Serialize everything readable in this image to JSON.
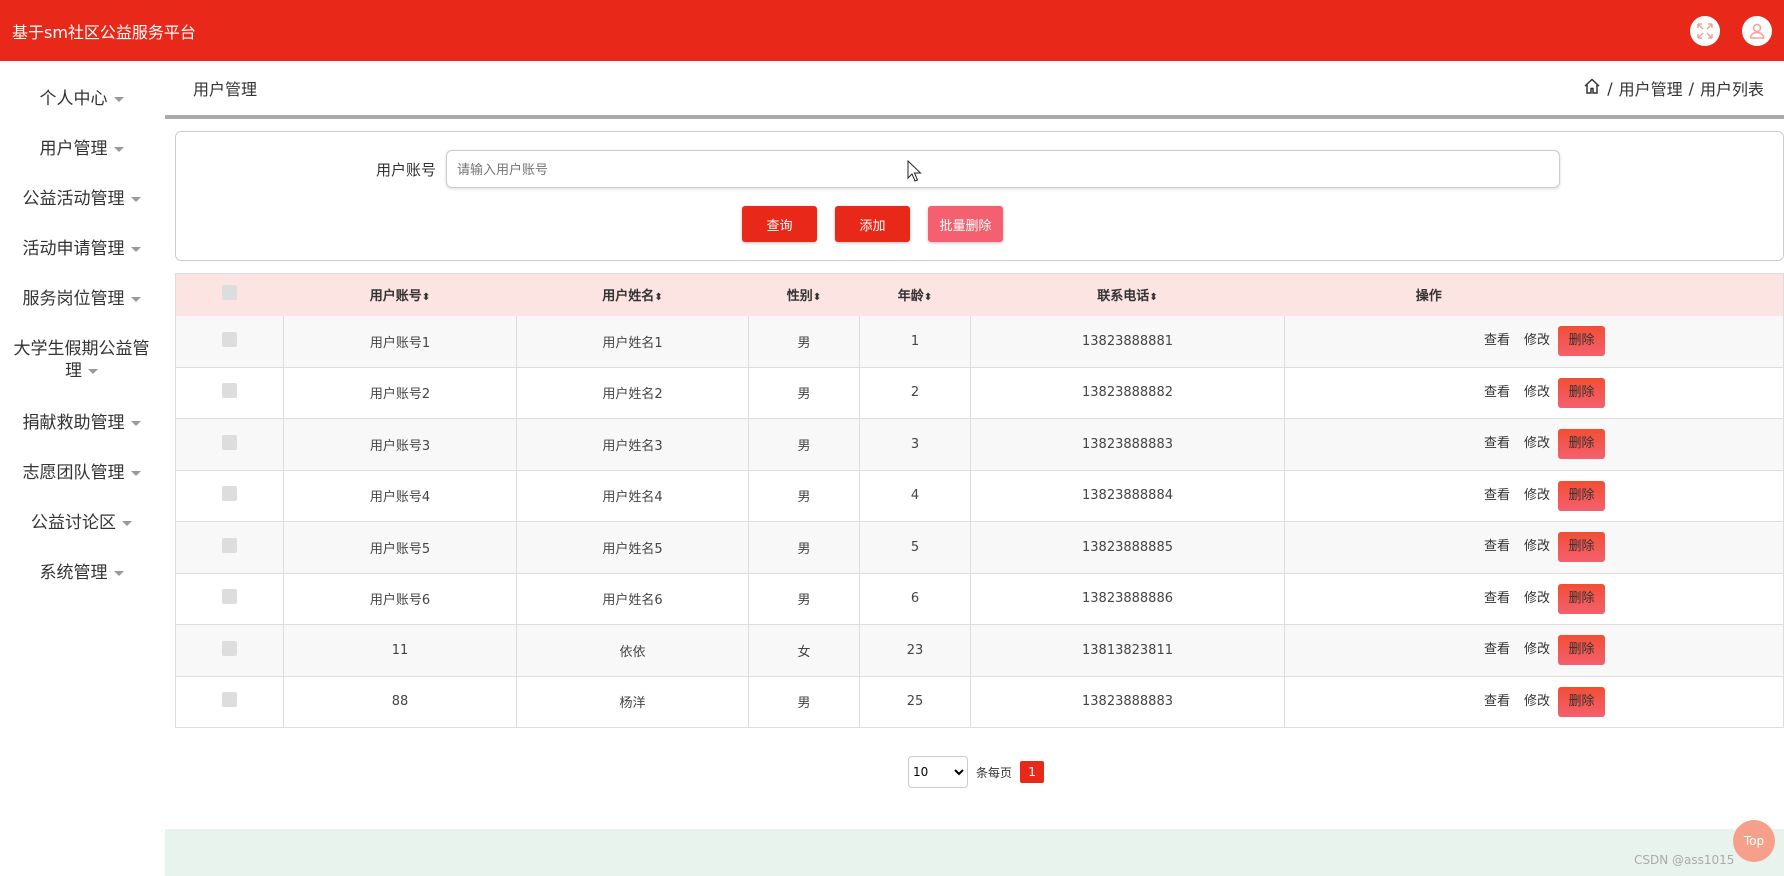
{
  "app": {
    "title": "基于sm社区公益服务平台"
  },
  "sidebar": {
    "items": [
      {
        "label": "个人中心"
      },
      {
        "label": "用户管理"
      },
      {
        "label": "公益活动管理"
      },
      {
        "label": "活动申请管理"
      },
      {
        "label": "服务岗位管理"
      },
      {
        "label": "大学生假期公益管理"
      },
      {
        "label": "捐献救助管理"
      },
      {
        "label": "志愿团队管理"
      },
      {
        "label": "公益讨论区"
      },
      {
        "label": "系统管理"
      }
    ]
  },
  "header": {
    "title": "用户管理",
    "breadcrumb": [
      "用户管理",
      "用户列表"
    ]
  },
  "search": {
    "label": "用户账号",
    "placeholder": "请输入用户账号",
    "query_label": "查询",
    "add_label": "添加",
    "batch_delete_label": "批量删除"
  },
  "table": {
    "columns": [
      "用户账号",
      "用户姓名",
      "性别",
      "年龄",
      "联系电话",
      "操作"
    ],
    "rows": [
      {
        "account": "用户账号1",
        "name": "用户姓名1",
        "gender": "男",
        "age": "1",
        "phone": "13823888881"
      },
      {
        "account": "用户账号2",
        "name": "用户姓名2",
        "gender": "男",
        "age": "2",
        "phone": "13823888882"
      },
      {
        "account": "用户账号3",
        "name": "用户姓名3",
        "gender": "男",
        "age": "3",
        "phone": "13823888883"
      },
      {
        "account": "用户账号4",
        "name": "用户姓名4",
        "gender": "男",
        "age": "4",
        "phone": "13823888884"
      },
      {
        "account": "用户账号5",
        "name": "用户姓名5",
        "gender": "男",
        "age": "5",
        "phone": "13823888885"
      },
      {
        "account": "用户账号6",
        "name": "用户姓名6",
        "gender": "男",
        "age": "6",
        "phone": "13823888886"
      },
      {
        "account": "11",
        "name": "依依",
        "gender": "女",
        "age": "23",
        "phone": "13813823811"
      },
      {
        "account": "88",
        "name": "杨洋",
        "gender": "男",
        "age": "25",
        "phone": "13823888883"
      }
    ],
    "actions": {
      "view": "查看",
      "edit": "修改",
      "delete": "删除"
    }
  },
  "pager": {
    "page_size": "10",
    "per_page_label": "条每页",
    "current_page": "1"
  },
  "back_to_top": "Top",
  "watermark": "CSDN @ass1015",
  "colors": {
    "brand": "#e8291a",
    "danger": "#f4606f"
  },
  "icons": {
    "fullscreen": "fullscreen-icon",
    "user": "user-icon",
    "home": "home-icon"
  }
}
